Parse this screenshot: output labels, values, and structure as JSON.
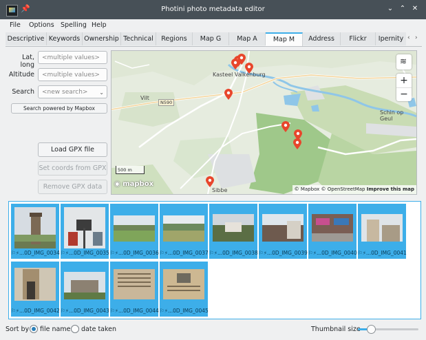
{
  "window": {
    "title": "Photini photo metadata editor",
    "pin_glyph": "📌",
    "btn_min": "⌄",
    "btn_max": "⌃",
    "btn_close": "✕"
  },
  "menu": [
    "File",
    "Options",
    "Spelling",
    "Help"
  ],
  "tabs": [
    {
      "label": "Descriptive"
    },
    {
      "label": "Keywords"
    },
    {
      "label": "Ownership"
    },
    {
      "label": "Technical"
    },
    {
      "label": "Regions"
    },
    {
      "label": "Map G"
    },
    {
      "label": "Map A"
    },
    {
      "label": "Map M",
      "active": true
    },
    {
      "label": "Address"
    },
    {
      "label": "Flickr"
    },
    {
      "label": "Ipernity"
    }
  ],
  "tab_scroll": {
    "left": "‹",
    "right": "›"
  },
  "form": {
    "latlong_label": "Lat, long",
    "latlong_placeholder": "<multiple values>",
    "altitude_label": "Altitude",
    "altitude_placeholder": "<multiple values>",
    "search_label": "Search",
    "search_placeholder": "<new search>",
    "search_powered": "Search powered by Mapbox",
    "load_gpx": "Load GPX file",
    "set_coords": "Set coords from GPX",
    "remove_gpx": "Remove GPX data"
  },
  "map": {
    "places": [
      "Kasteel Valkenburg",
      "Vilt",
      "N590",
      "Schin op Geul",
      "Sibbe"
    ],
    "scale": "500 m",
    "logo": "mapbox",
    "attribution": [
      "© Mapbox",
      "© OpenStreetMap",
      "Improve this map"
    ],
    "zoom_in": "+",
    "zoom_out": "−"
  },
  "thumbnails": [
    {
      "caption": "...0D_IMG_0034"
    },
    {
      "caption": "...0D_IMG_0035"
    },
    {
      "caption": "...0D_IMG_0036"
    },
    {
      "caption": "...0D_IMG_0037"
    },
    {
      "caption": "...0D_IMG_0038"
    },
    {
      "caption": "...0D_IMG_0039"
    },
    {
      "caption": "...0D_IMG_0040"
    },
    {
      "caption": "...0D_IMG_0041"
    },
    {
      "caption": "...0D_IMG_0042"
    },
    {
      "caption": "...0D_IMG_0043"
    },
    {
      "caption": "...0D_IMG_0044"
    },
    {
      "caption": "...0D_IMG_0045"
    }
  ],
  "bottom": {
    "sort_by": "Sort by",
    "file_name": "file name",
    "date_taken": "date taken",
    "thumb_size": "Thumbnail size",
    "sort_selected": "file name"
  },
  "colors": {
    "accent": "#3daee9",
    "titlebar": "#475057",
    "marker": "#e8462c"
  }
}
